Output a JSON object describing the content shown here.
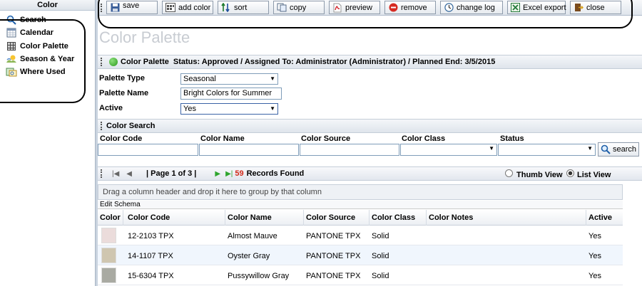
{
  "sidebar": {
    "title": "Color",
    "items": [
      {
        "label": "Search",
        "icon": "search-icon"
      },
      {
        "label": "Calendar",
        "icon": "calendar-icon"
      },
      {
        "label": "Color Palette",
        "icon": "palette-grid-icon"
      },
      {
        "label": "Season & Year",
        "icon": "season-icon"
      },
      {
        "label": "Where Used",
        "icon": "where-used-icon"
      }
    ]
  },
  "toolbar": {
    "save": "save",
    "add_color": "add color",
    "sort": "sort",
    "copy": "copy",
    "preview": "preview",
    "remove": "remove",
    "change_log": "change log",
    "excel_export": "Excel export",
    "close": "close"
  },
  "page": {
    "title": "Color Palette"
  },
  "status_bar": {
    "name": "Color Palette",
    "text": "Status: Approved / Assigned To: Administrator (Administrator) / Planned End: 3/5/2015"
  },
  "form": {
    "palette_type_label": "Palette Type",
    "palette_type_value": "Seasonal",
    "palette_name_label": "Palette Name",
    "palette_name_value": "Bright Colors for Summer",
    "active_label": "Active",
    "active_value": "Yes"
  },
  "color_search": {
    "title": "Color Search",
    "headers": {
      "color_code": "Color Code",
      "color_name": "Color Name",
      "color_source": "Color Source",
      "color_class": "Color Class",
      "status": "Status"
    },
    "search_button": "search"
  },
  "pager": {
    "page_text": "| Page 1 of 3 |",
    "record_count": "59",
    "records_label": "Records Found",
    "thumb_view": "Thumb View",
    "list_view": "List View"
  },
  "grid": {
    "group_hint": "Drag a column header and drop it here to group by that column",
    "edit_schema": "Edit Schema",
    "columns": {
      "color": "Color",
      "color_code": "Color Code",
      "color_name": "Color Name",
      "color_source": "Color Source",
      "color_class": "Color Class",
      "color_notes": "Color Notes",
      "active": "Active"
    },
    "rows": [
      {
        "swatch": "#ebdcdb",
        "code": "12-2103 TPX",
        "name": "Almost Mauve",
        "source": "PANTONE TPX",
        "class": "Solid",
        "notes": "",
        "active": "Yes"
      },
      {
        "swatch": "#cfc6b0",
        "code": "14-1107 TPX",
        "name": "Oyster Gray",
        "source": "PANTONE TPX",
        "class": "Solid",
        "notes": "",
        "active": "Yes"
      },
      {
        "swatch": "#a9aaa2",
        "code": "15-6304 TPX",
        "name": "Pussywillow Gray",
        "source": "PANTONE TPX",
        "class": "Solid",
        "notes": "",
        "active": "Yes"
      }
    ]
  }
}
